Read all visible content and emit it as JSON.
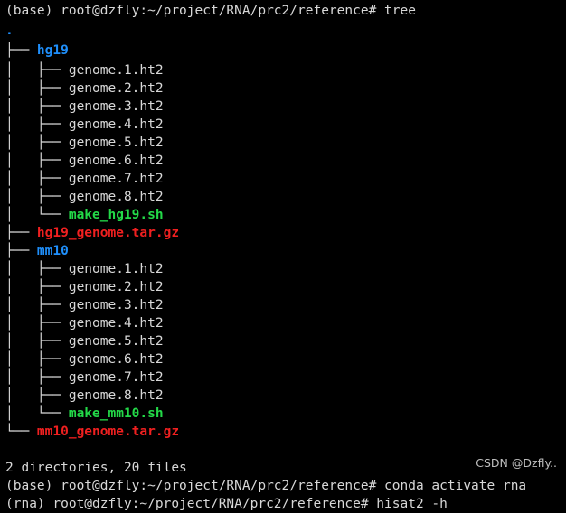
{
  "terminal": {
    "background_color": "#000000",
    "foreground_color": "#d8d8d8",
    "dir_color": "#1f8ffb",
    "exec_color": "#23d948",
    "archive_color": "#f02020",
    "prompt_line_1": "(base) root@dzfly:~/project/RNA/prc2/reference# tree",
    "root_node": ".",
    "tree_lines": [
      {
        "prefix": "├── ",
        "name": "hg19",
        "type": "dir"
      },
      {
        "prefix": "│   ├── ",
        "name": "genome.1.ht2",
        "type": "file"
      },
      {
        "prefix": "│   ├── ",
        "name": "genome.2.ht2",
        "type": "file"
      },
      {
        "prefix": "│   ├── ",
        "name": "genome.3.ht2",
        "type": "file"
      },
      {
        "prefix": "│   ├── ",
        "name": "genome.4.ht2",
        "type": "file"
      },
      {
        "prefix": "│   ├── ",
        "name": "genome.5.ht2",
        "type": "file"
      },
      {
        "prefix": "│   ├── ",
        "name": "genome.6.ht2",
        "type": "file"
      },
      {
        "prefix": "│   ├── ",
        "name": "genome.7.ht2",
        "type": "file"
      },
      {
        "prefix": "│   ├── ",
        "name": "genome.8.ht2",
        "type": "file"
      },
      {
        "prefix": "│   └── ",
        "name": "make_hg19.sh",
        "type": "exec"
      },
      {
        "prefix": "├── ",
        "name": "hg19_genome.tar.gz",
        "type": "archive"
      },
      {
        "prefix": "├── ",
        "name": "mm10",
        "type": "dir"
      },
      {
        "prefix": "│   ├── ",
        "name": "genome.1.ht2",
        "type": "file"
      },
      {
        "prefix": "│   ├── ",
        "name": "genome.2.ht2",
        "type": "file"
      },
      {
        "prefix": "│   ├── ",
        "name": "genome.3.ht2",
        "type": "file"
      },
      {
        "prefix": "│   ├── ",
        "name": "genome.4.ht2",
        "type": "file"
      },
      {
        "prefix": "│   ├── ",
        "name": "genome.5.ht2",
        "type": "file"
      },
      {
        "prefix": "│   ├── ",
        "name": "genome.6.ht2",
        "type": "file"
      },
      {
        "prefix": "│   ├── ",
        "name": "genome.7.ht2",
        "type": "file"
      },
      {
        "prefix": "│   ├── ",
        "name": "genome.8.ht2",
        "type": "file"
      },
      {
        "prefix": "│   └── ",
        "name": "make_mm10.sh",
        "type": "exec"
      },
      {
        "prefix": "└── ",
        "name": "mm10_genome.tar.gz",
        "type": "archive"
      }
    ],
    "summary": "2 directories, 20 files",
    "prompt_line_2": "(base) root@dzfly:~/project/RNA/prc2/reference# conda activate rna",
    "prompt_line_3": "(rna) root@dzfly:~/project/RNA/prc2/reference# hisat2 -h",
    "watermark": "CSDN @Dzfly.."
  }
}
